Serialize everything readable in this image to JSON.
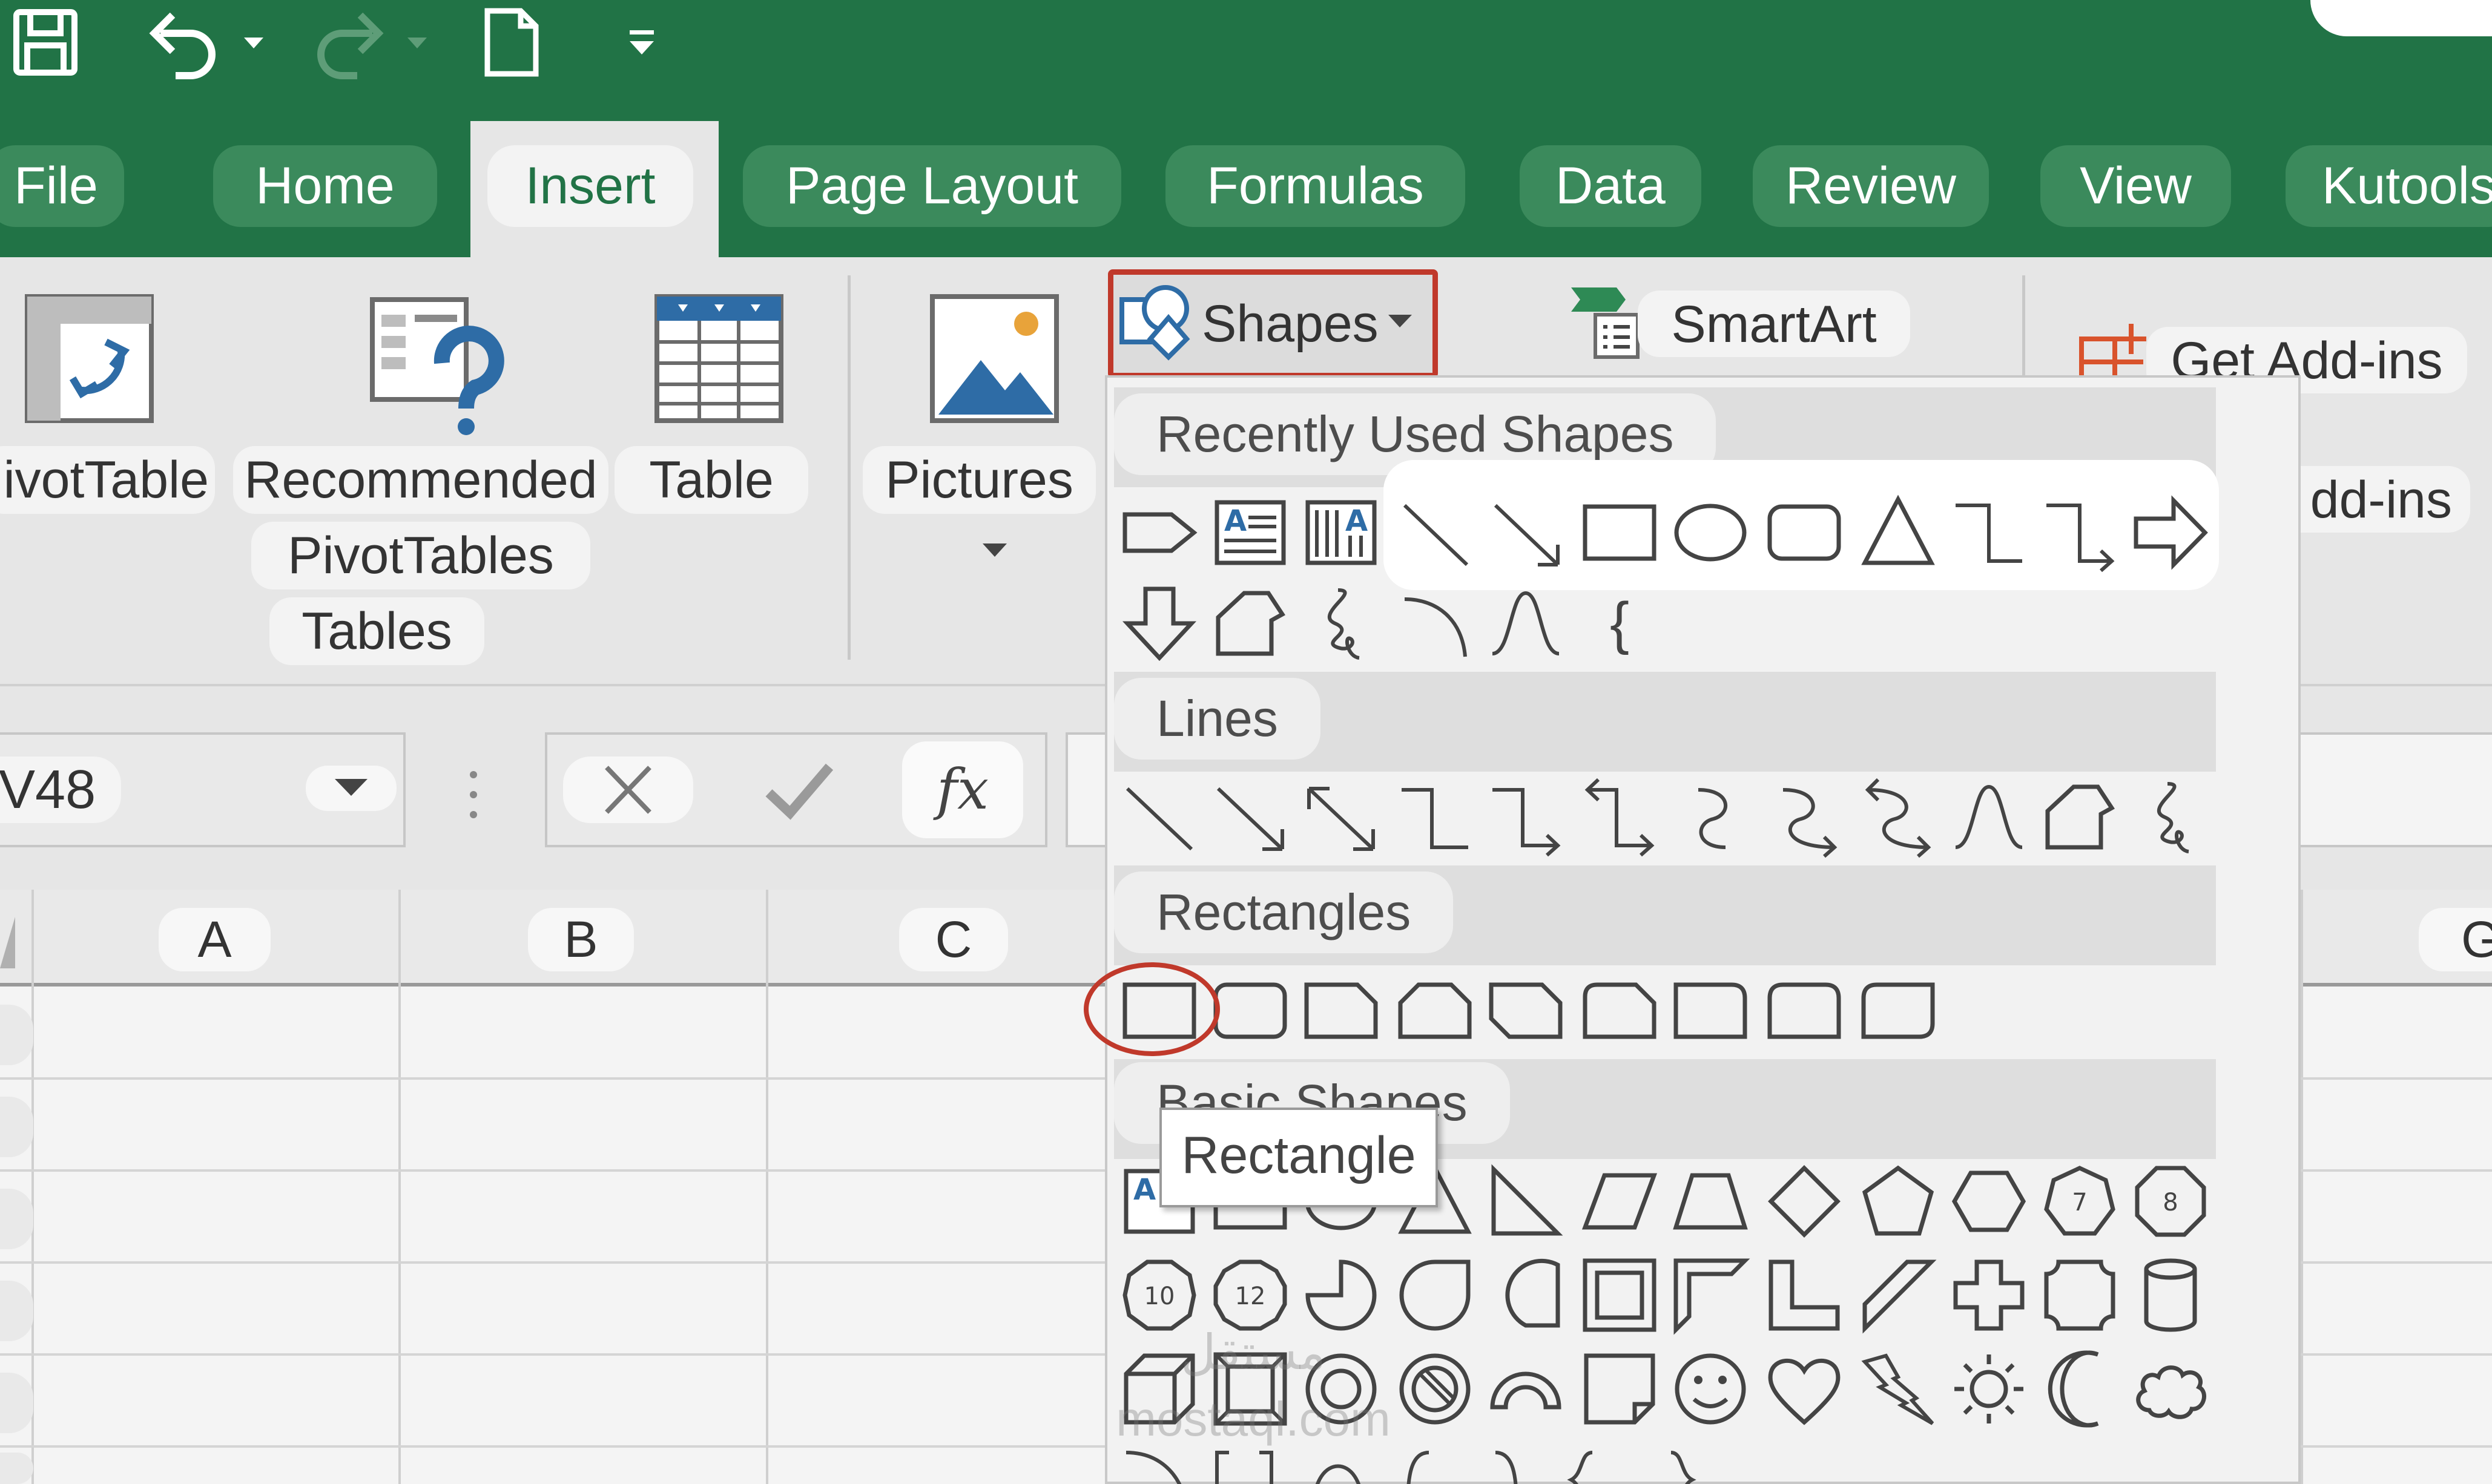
{
  "quick_access": {
    "icons": [
      "save-icon",
      "undo-icon",
      "redo-icon",
      "new-file-icon",
      "customize-qat-icon"
    ]
  },
  "tabs": [
    "File",
    "Home",
    "Insert",
    "Page Layout",
    "Formulas",
    "Data",
    "Review",
    "View",
    "Kutools"
  ],
  "active_tab": "Insert",
  "ribbon": {
    "pivot_table": "ivotTable",
    "recommended_line1": "Recommended",
    "recommended_line2": "PivotTables",
    "table": "Table",
    "group_tables": "Tables",
    "pictures": "Pictures",
    "shapes": "Shapes",
    "smartart": "SmartArt",
    "get_addins": "Get Add-ins",
    "my_addins": "dd-ins"
  },
  "formula_bar": {
    "name_box": "V48",
    "fx": "fx"
  },
  "columns": [
    "A",
    "B",
    "C",
    "G"
  ],
  "gallery": {
    "sections": [
      "Recently Used Shapes",
      "Lines",
      "Rectangles",
      "Basic Shapes"
    ],
    "tooltip": "Rectangle",
    "octagon_labels": [
      "7",
      "8",
      "10",
      "12"
    ],
    "brace_left": "{"
  },
  "highlight_color": "#c0392b",
  "accent_color": "#217346",
  "watermark": "مستقل mostaql.com"
}
